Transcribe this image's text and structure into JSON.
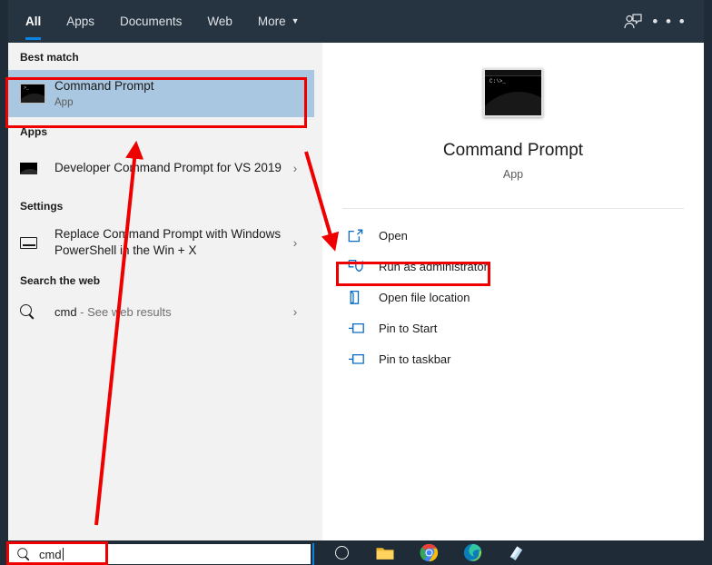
{
  "window": {
    "title": "Windows Search",
    "accent_color": "#0a84e0",
    "header_bg": "#263340",
    "selection_color": "#a9c7e0",
    "annotation_color": "#ee0000"
  },
  "header": {
    "tabs": [
      {
        "label": "All",
        "active": true
      },
      {
        "label": "Apps",
        "active": false
      },
      {
        "label": "Documents",
        "active": false
      },
      {
        "label": "Web",
        "active": false
      },
      {
        "label": "More",
        "active": false,
        "caret": "▼"
      }
    ],
    "feedback_icon": "person-feedback-icon",
    "more_icon": "• • •"
  },
  "results": {
    "sections": [
      {
        "heading": "Best match",
        "items": [
          {
            "title": "Command Prompt",
            "subtitle": "App",
            "icon": "command-prompt-icon",
            "selected": true,
            "chevron": ""
          }
        ]
      },
      {
        "heading": "Apps",
        "items": [
          {
            "title": "Developer Command Prompt for VS 2019",
            "subtitle": "",
            "icon": "command-prompt-small-icon",
            "selected": false,
            "chevron": "›"
          }
        ]
      },
      {
        "heading": "Settings",
        "items": [
          {
            "title": "Replace Command Prompt with Windows PowerShell in the Win + X",
            "subtitle": "",
            "icon": "settings-icon",
            "selected": false,
            "chevron": "›"
          }
        ]
      }
    ],
    "web_section": {
      "heading": "Search the web",
      "query": "cmd",
      "suffix": " - See web results",
      "icon": "search-icon",
      "chevron": "›"
    }
  },
  "preview": {
    "icon": "command-prompt-large-icon",
    "title": "Command Prompt",
    "subtitle": "App",
    "actions": [
      {
        "label": "Open",
        "icon": "open-external-icon",
        "highlighted": false
      },
      {
        "label": "Run as administrator",
        "icon": "shield-run-icon",
        "highlighted": true
      },
      {
        "label": "Open file location",
        "icon": "folder-location-icon",
        "highlighted": false
      },
      {
        "label": "Pin to Start",
        "icon": "pin-icon",
        "highlighted": false
      },
      {
        "label": "Pin to taskbar",
        "icon": "pin-icon",
        "highlighted": false
      }
    ]
  },
  "taskbar": {
    "search": {
      "value": "cmd",
      "placeholder": "Type here to search",
      "icon": "search-icon"
    },
    "items": [
      {
        "name": "cortana-button",
        "icon": "cortana-circle-icon"
      },
      {
        "name": "file-explorer-button",
        "icon": "file-explorer-icon"
      },
      {
        "name": "chrome-button",
        "icon": "chrome-icon"
      },
      {
        "name": "edge-button",
        "icon": "edge-icon"
      },
      {
        "name": "sticky-notes-button",
        "icon": "sticky-notes-icon"
      }
    ]
  },
  "annotations": {
    "box_best_match": "highlight-best-match",
    "box_run_as_admin": "highlight-run-as-administrator",
    "box_search": "highlight-search-box",
    "arrow_search_to_results": "arrow-from-search-to-results",
    "arrow_results_to_actions": "arrow-from-best-match-to-actions"
  }
}
